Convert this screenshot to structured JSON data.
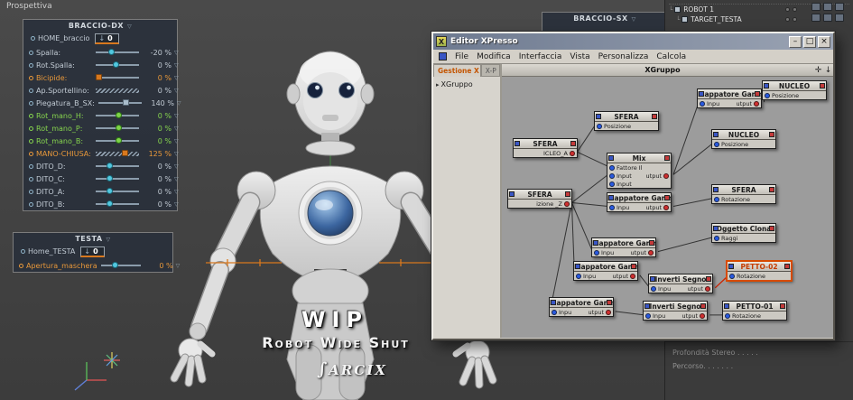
{
  "viewport": {
    "label": "Prospettiva"
  },
  "watermark": {
    "title": "WIP",
    "subtitle": "Robot Wide Shut",
    "logo_glyph": "∫",
    "logo_text": "ARCIX"
  },
  "hud": {
    "braccio_dx": {
      "title": "BRACCIO-DX",
      "home_label": "HOME_braccio",
      "home_value": "0",
      "sliders": [
        {
          "label": "Spalla:",
          "value": "-20 %"
        },
        {
          "label": "Rot.Spalla:",
          "value": "0 %"
        },
        {
          "label": "Bicipide:",
          "value": "0 %"
        },
        {
          "label": "Ap.Sportellino:",
          "value": "0 %"
        },
        {
          "label": "Piegatura_B_SX:",
          "value": "140 %"
        },
        {
          "label": "Rot_mano_H:",
          "value": "0 %"
        },
        {
          "label": "Rot_mano_P:",
          "value": "0 %"
        },
        {
          "label": "Rot_mano_B:",
          "value": "0 %"
        },
        {
          "label": "MANO-CHIUSA:",
          "value": "125 %"
        },
        {
          "label": "DITO_D:",
          "value": "0 %"
        },
        {
          "label": "DITO_C:",
          "value": "0 %"
        },
        {
          "label": "DITO_A:",
          "value": "0 %"
        },
        {
          "label": "DITO_B:",
          "value": "0 %"
        }
      ]
    },
    "testa": {
      "title": "TESTA",
      "home_label": "Home_TESTA",
      "home_value": "0",
      "slider_label": "Apertura_maschera",
      "slider_value": "0 %"
    },
    "braccio_sx": {
      "title": "BRACCIO-SX"
    }
  },
  "object_manager": {
    "items": [
      {
        "label": "ROBOT 1"
      },
      {
        "label": "TARGET_TESTA"
      }
    ]
  },
  "bottom_panel": {
    "rows": [
      {
        "label": "Profondità Stereo . . . . ."
      },
      {
        "label": "Percorso. . . . . . ."
      }
    ]
  },
  "xpresso": {
    "title": "Editor XPresso",
    "menus": [
      "File",
      "Modifica",
      "Interfaccia",
      "Vista",
      "Personalizza",
      "Calcola"
    ],
    "tabs": [
      {
        "label": "Gestione X"
      },
      {
        "label": "X-P"
      }
    ],
    "tree_item": "XGruppo",
    "group_title": "XGruppo",
    "pan_icon": "✛",
    "zoom_icon": "↓",
    "nodes": [
      {
        "title": "SFERA",
        "l0": "Posizione"
      },
      {
        "title": "SFERA",
        "r0": "ICLEO_A"
      },
      {
        "title": "Mix",
        "l0": "Fattore Il",
        "l1": "Input",
        "r1": "utput",
        "l2": "Input"
      },
      {
        "title": "Mappatore Gamm",
        "l0": "Inpu",
        "r0": "utput"
      },
      {
        "title": "NUCLEO",
        "l0": "Posizione"
      },
      {
        "title": "NUCLEO",
        "l0": "Posizione"
      },
      {
        "title": "SFERA",
        "l0": "Rotazione"
      },
      {
        "title": "Mappatore Gamma",
        "l0": "Inpu",
        "r0": "utput"
      },
      {
        "title": "SFERA",
        "r0": "izione _Z"
      },
      {
        "title": "Mappatore Gamma",
        "l0": "Inpu",
        "r0": "utput"
      },
      {
        "title": "Oggetto Clona",
        "l0": "Raggi"
      },
      {
        "title": "Mappatore Gamma",
        "l0": "Inpu",
        "r0": "utput"
      },
      {
        "title": "Inverti Segno",
        "l0": "Inpu",
        "r0": "utput"
      },
      {
        "title": "PETTO-02",
        "l0": "Rotazione"
      },
      {
        "title": "Mappatore Gamma",
        "l0": "Inpu",
        "r0": "utput"
      },
      {
        "title": "Inverti Segno",
        "l0": "Inpu",
        "r0": "utput"
      },
      {
        "title": "PETTO-01",
        "l0": "Rotazione"
      }
    ]
  }
}
